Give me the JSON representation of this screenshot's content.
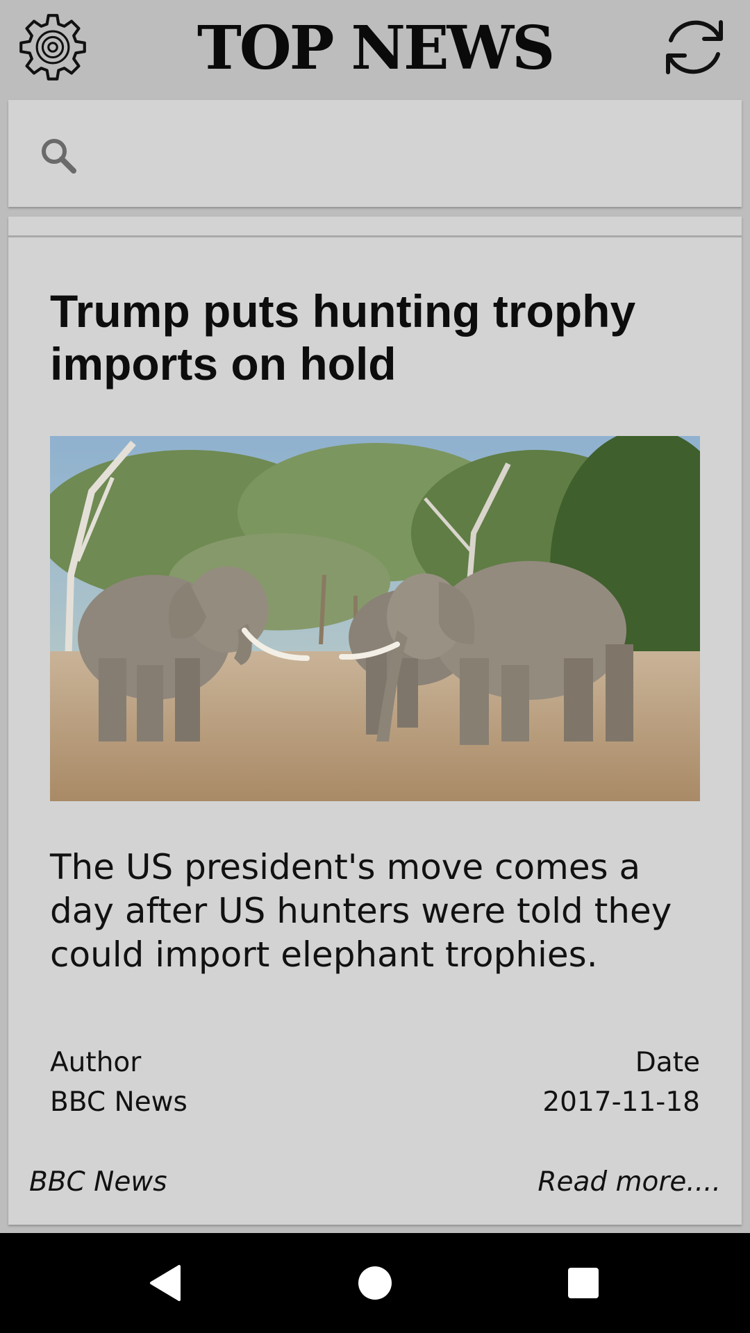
{
  "header": {
    "title": "TOP NEWS",
    "settings_icon": "gear-icon",
    "refresh_icon": "refresh-icon"
  },
  "search": {
    "icon": "search-icon",
    "value": "",
    "placeholder": ""
  },
  "article": {
    "headline": "Trump puts hunting trophy imports on hold",
    "image": "elephants-photo",
    "summary": "The US president's move comes a day after US hunters were told they could import elephant trophies.",
    "author_label": "Author",
    "author": "BBC News",
    "date_label": "Date",
    "date": "2017-11-18",
    "source": "BBC News",
    "read_more": "Read more...."
  },
  "system_nav": {
    "back_icon": "back-triangle-icon",
    "home_icon": "home-circle-icon",
    "recents_icon": "recents-square-icon"
  },
  "colors": {
    "background": "#bdbdbd",
    "card": "#d3d3d3",
    "navbar": "#000000"
  }
}
